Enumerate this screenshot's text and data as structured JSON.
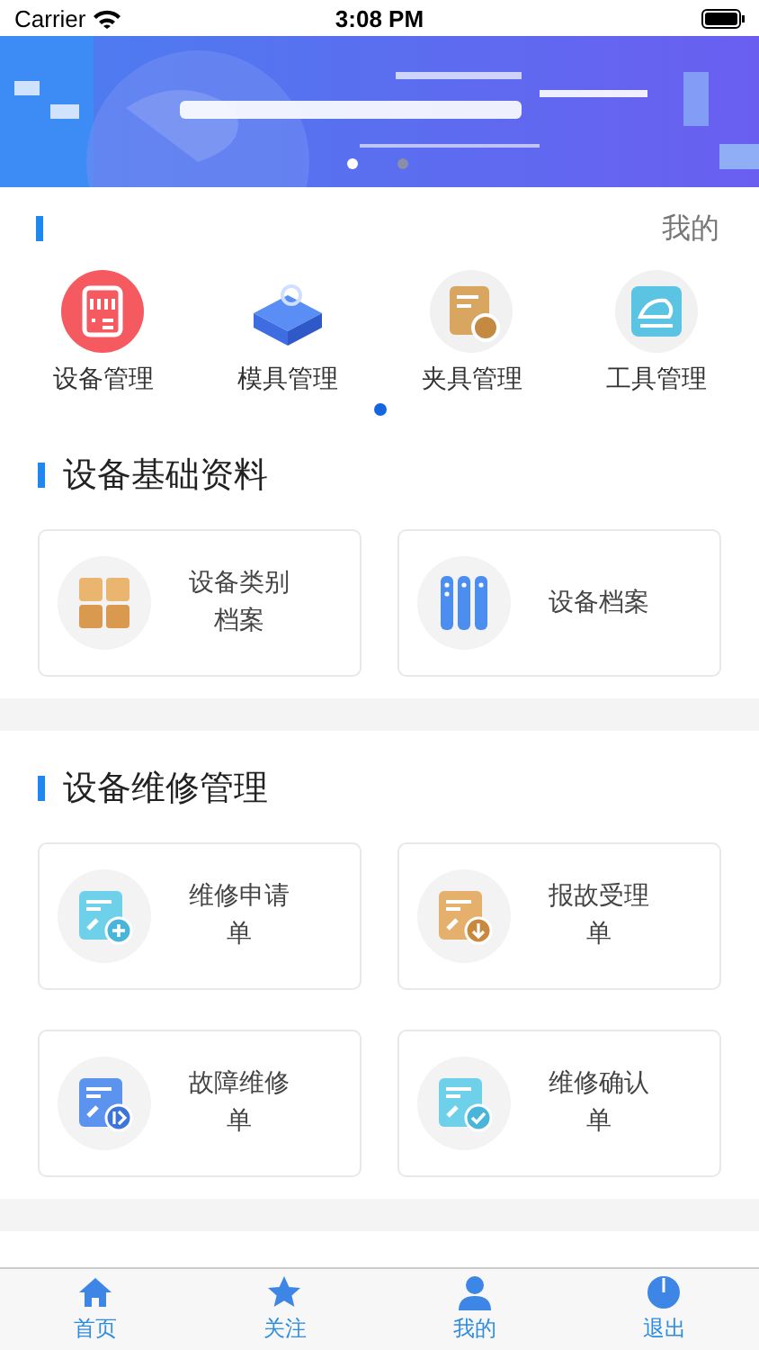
{
  "status_bar": {
    "carrier": "Carrier",
    "time": "3:08 PM"
  },
  "banner": {
    "dots": [
      {
        "selected": true
      },
      {
        "selected": false
      }
    ]
  },
  "notice": {
    "text": "我的"
  },
  "quick_menu": {
    "items": [
      {
        "label": "设备管理",
        "kind": "panel"
      },
      {
        "label": "模具管理",
        "kind": "block"
      },
      {
        "label": "夹具管理",
        "kind": "clip"
      },
      {
        "label": "工具管理",
        "kind": "tool"
      }
    ],
    "pages": [
      {
        "selected": true
      }
    ]
  },
  "sections": [
    {
      "title": "设备基础资料",
      "cards": [
        {
          "label": "设备类别档案",
          "kind": "grid"
        },
        {
          "label": "设备档案",
          "kind": "columns"
        }
      ]
    },
    {
      "title": "设备维修管理",
      "cards": [
        {
          "label": "维修申请单",
          "kind": "plus"
        },
        {
          "label": "报故受理单",
          "kind": "down"
        },
        {
          "label": "故障维修单",
          "kind": "play"
        },
        {
          "label": "维修确认单",
          "kind": "check"
        }
      ]
    }
  ],
  "tab_bar": [
    {
      "label": "首页",
      "kind": "home"
    },
    {
      "label": "关注",
      "kind": "star"
    },
    {
      "label": "我的",
      "kind": "person"
    },
    {
      "label": "退出",
      "kind": "power"
    }
  ]
}
